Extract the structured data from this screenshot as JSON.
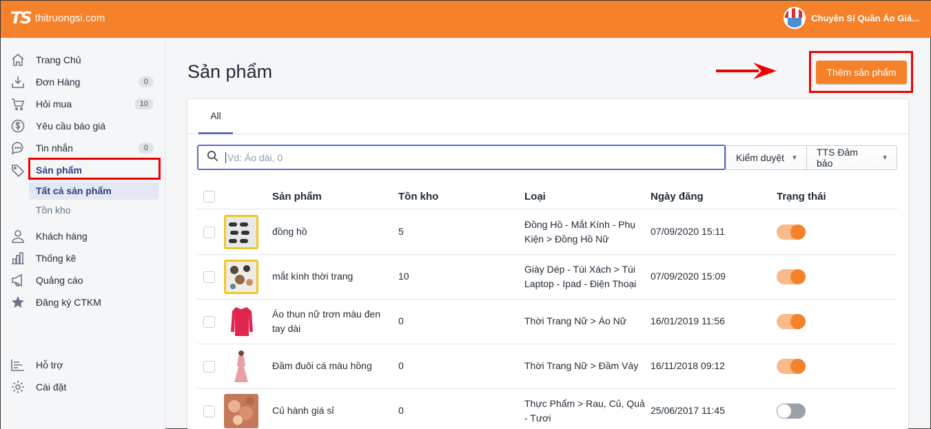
{
  "header": {
    "logo_mark": "TS",
    "logo_text": "thitruongsi.com",
    "shop_name": "Chuyên Sỉ Quần Áo Giá..."
  },
  "sidebar": {
    "items": [
      {
        "label": "Trang Chủ"
      },
      {
        "label": "Đơn Hàng",
        "badge": "0"
      },
      {
        "label": "Hỏi mua",
        "badge": "10"
      },
      {
        "label": "Yêu cầu báo giá"
      },
      {
        "label": "Tin nhắn",
        "badge": "0"
      },
      {
        "label": "Sản phẩm"
      },
      {
        "label": "Khách hàng"
      },
      {
        "label": "Thống kê"
      },
      {
        "label": "Quảng cáo"
      },
      {
        "label": "Đăng ký CTKM"
      },
      {
        "label": "Hỗ trợ"
      },
      {
        "label": "Cài đặt"
      }
    ],
    "sub_items": [
      {
        "label": "Tất cả sản phẩm"
      },
      {
        "label": "Tồn kho"
      }
    ]
  },
  "main": {
    "title": "Sản phẩm",
    "add_button": "Thêm sản phẩm",
    "tab_all": "All",
    "search_placeholder": "Vd: Áo dài, 0",
    "filter_review": "Kiểm duyệt",
    "filter_guarantee": "TTS Đảm bảo",
    "columns": {
      "product": "Sản phẩm",
      "stock": "Tồn kho",
      "category": "Loại",
      "date": "Ngày đăng",
      "status": "Trạng thái"
    },
    "rows": [
      {
        "name": "đồng hồ",
        "stock": "5",
        "category_1": "Đồng Hồ - Mắt Kính - Phụ",
        "category_2": "Kiện > Đồng Hồ Nữ",
        "date": "07/09/2020 15:11",
        "status_on": true
      },
      {
        "name": "mắt kính thời trang",
        "stock": "10",
        "category_1": "Giày Dép - Túi Xách > Túi",
        "category_2": "Laptop - Ipad - Điện Thoại",
        "date": "07/09/2020 15:09",
        "status_on": true
      },
      {
        "name_1": "Áo thun nữ trơn màu đen",
        "name_2": "tay dài",
        "stock": "0",
        "category": "Thời Trang Nữ > Áo Nữ",
        "date": "16/01/2019 11:56",
        "status_on": true
      },
      {
        "name": "Đầm đuôi cá màu hồng",
        "stock": "0",
        "category": "Thời Trang Nữ > Đầm Váy",
        "date": "16/11/2018 09:12",
        "status_on": true
      },
      {
        "name": "Củ hành giá sỉ",
        "stock": "0",
        "category_1": "Thực Phẩm > Rau, Củ, Quả",
        "category_2": "- Tươi",
        "date": "25/06/2017 11:45",
        "status_on": false
      }
    ]
  },
  "colors": {
    "brand": "#f5822a",
    "accent": "#5c6ac4",
    "highlight": "#e00000"
  }
}
